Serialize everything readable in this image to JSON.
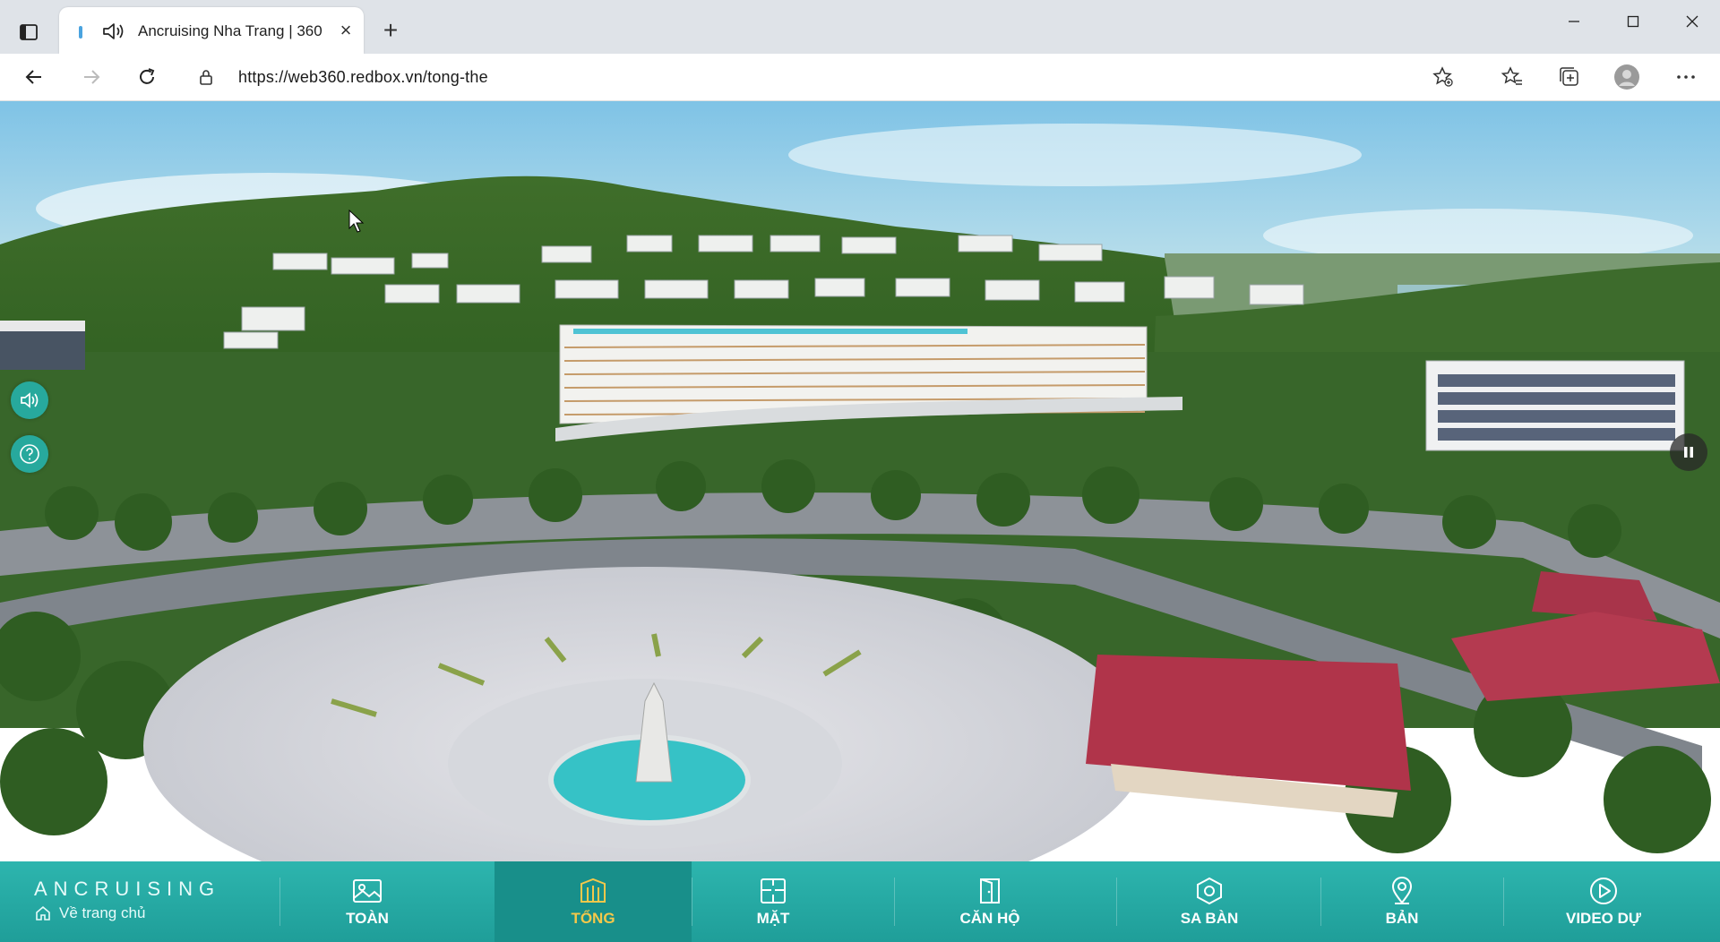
{
  "browser": {
    "tab": {
      "title": "Ancruising Nha Trang | 360",
      "close": "×"
    },
    "new_tab": "+",
    "url": "https://web360.redbox.vn/tong-the"
  },
  "brand": {
    "name": "ANCRUISING",
    "home_label": "Về trang chủ"
  },
  "nav": {
    "items": [
      {
        "label": "TOÀN",
        "icon": "image-icon",
        "active": false
      },
      {
        "label": "TỔNG",
        "icon": "building-icon",
        "active": true
      },
      {
        "label": "MẶT",
        "icon": "floorplan-icon",
        "active": false
      },
      {
        "label": "CĂN HỘ",
        "icon": "door-icon",
        "active": false
      },
      {
        "label": "SA BÀN",
        "icon": "model-icon",
        "active": false
      },
      {
        "label": "BẢN",
        "icon": "map-pin-icon",
        "active": false
      },
      {
        "label": "VIDEO DỰ",
        "icon": "play-icon",
        "active": false
      }
    ]
  },
  "colors": {
    "accent": "#2db5ae",
    "active_text": "#f5c84a",
    "roof": "#b0344a"
  }
}
